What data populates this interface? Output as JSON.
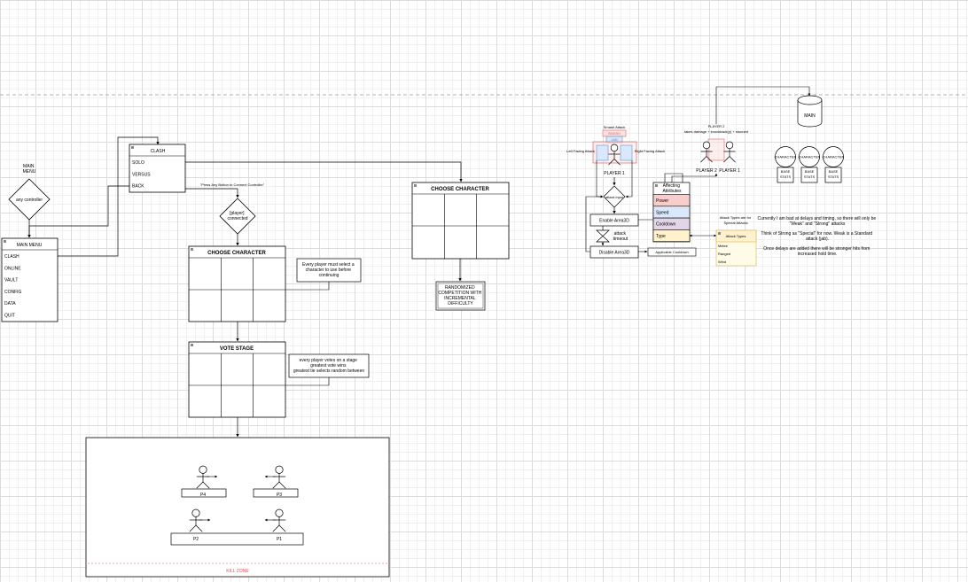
{
  "colors": {
    "power": "#f8cecc",
    "speed": "#dae8fc",
    "cooldown": "#e1d5e7",
    "type": "#fff2cc",
    "kill_zone": "#e85050",
    "line": "#000000"
  },
  "start": {
    "label": "MAIN\nMENU",
    "diamond": "any controller"
  },
  "main_menu": {
    "title": "MAIN MENU",
    "items": [
      "CLASH",
      "ONLINE",
      "VAULT",
      "CONFIG",
      "DATA",
      "QUIT"
    ]
  },
  "clash_menu": {
    "title": "CLASH",
    "items": [
      "SOLO",
      "VERSUS",
      "BACK"
    ]
  },
  "connect": {
    "note": "\"Press Any Button to Connect Controller\"",
    "diamond": "[player]\nconnected"
  },
  "choose_character_1": {
    "title": "CHOOSE CHARACTER",
    "note": "Every player must select a\ncharacter to use before\ncontinuing"
  },
  "vote_stage": {
    "title": "VOTE STAGE",
    "note": "every player votes on a stage\ngreatest vote wins\ngreatest tie selects random between"
  },
  "arena": {
    "players": [
      "P4",
      "P3",
      "P2",
      "P1"
    ],
    "kill_zone": "KILL ZONE"
  },
  "choose_character_2": {
    "title": "CHOOSE CHARACTER",
    "result": "RANDOMIZED\nCOMPETITION WITH\nINCREMENTAL\nDIFFICULTY"
  },
  "combat": {
    "smash_attack": "Smash Attack",
    "top_box_1": "SMASH",
    "top_box_2": "JAB",
    "left_facing": "Left Facing Attack",
    "right_facing": "Right Facing Attack",
    "player1": "PLAYER 1",
    "decision": "attack input",
    "enable": "Enable Area3D",
    "timeout": "attack\ntimeout",
    "disable": "Disable Area3D",
    "cooldown_box": "Applicable Cooldown",
    "attributes_title": "Affecting\nAttributes",
    "attributes": [
      "Power",
      "Speed",
      "Cooldown",
      "Type"
    ]
  },
  "player2_block": {
    "title": "PLAYER 2",
    "formula": "takes damage + knockback(y) + stunned",
    "player2": "PLAYER 2",
    "player1": "PLAYER 1"
  },
  "main_db": "MAIN",
  "characters": [
    {
      "name": "CHARACTER",
      "stats": "BASE\nSTATS"
    },
    {
      "name": "CHARACTER",
      "stats": "BASE\nSTATS"
    },
    {
      "name": "CHARACTER",
      "stats": "BASE\nSTATS"
    }
  ],
  "attack_types": {
    "note": "Attack Types are for\nSpecial Attacks",
    "title": "Attack Types",
    "items": [
      "Melee",
      "Ranged",
      "Wind"
    ]
  },
  "notes": {
    "n1": "Currently I am bad at delays and timing, so there will only be\n\"Weak\" and \"Strong\" attacks",
    "n2": "Think of Strong as \"Special\" for now. Weak is a Standard\nattack (jab).",
    "n3": "Once delays are added there will be stronger hits from\nincreased hold time."
  }
}
